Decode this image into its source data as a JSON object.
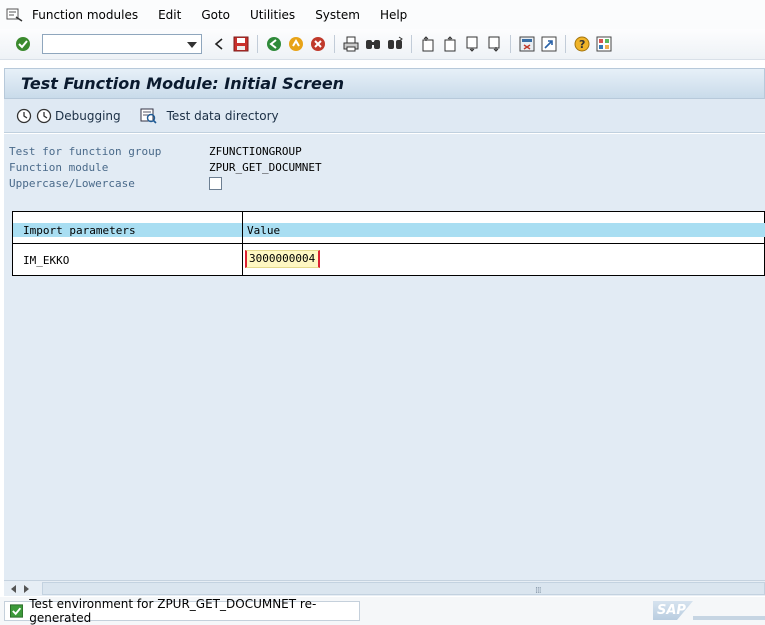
{
  "menubar": {
    "items": [
      "Function modules",
      "Edit",
      "Goto",
      "Utilities",
      "System",
      "Help"
    ]
  },
  "toolbar": {
    "command_field_value": "",
    "icons": [
      "enter-icon",
      "back-nav-icon",
      "save-icon",
      "back-icon",
      "exit-icon",
      "cancel-icon",
      "print-icon",
      "find-icon",
      "find-next-icon",
      "first-page-icon",
      "previous-page-icon",
      "next-page-icon",
      "last-page-icon",
      "create-session-icon",
      "shortcut-icon",
      "help-icon",
      "layout-icon"
    ]
  },
  "title": "Test Function Module: Initial Screen",
  "app_toolbar": {
    "debugging_label": "Debugging",
    "test_data_label": "Test data directory"
  },
  "fields": {
    "function_group_label": "Test for function group",
    "function_group_value": "ZFUNCTIONGROUP",
    "function_module_label": "Function module",
    "function_module_value": "ZPUR_GET_DOCUMNET",
    "uppercase_label": "Uppercase/Lowercase",
    "uppercase_checked": false
  },
  "params_table": {
    "headers": [
      "Import parameters",
      "Value"
    ],
    "rows": [
      {
        "parameter": "IM_EKKO",
        "value": "3000000004"
      }
    ]
  },
  "status": {
    "message": "Test environment for ZPUR_GET_DOCUMNET re-generated",
    "type": "success"
  },
  "colors": {
    "accent": "#a9def2",
    "value_highlight": "#fef7c2",
    "label_text": "#4a6a8a",
    "background": "#e2ebf4"
  }
}
